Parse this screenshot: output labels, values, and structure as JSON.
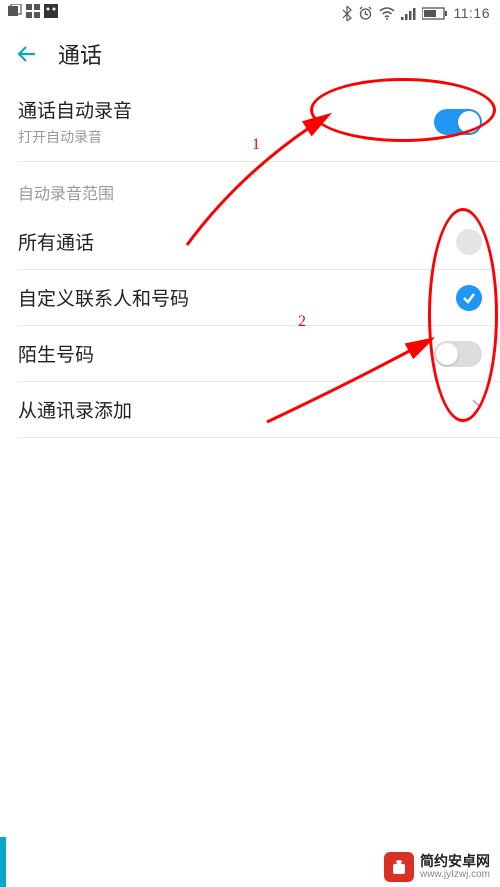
{
  "status": {
    "time": "11:16"
  },
  "header": {
    "title": "通话"
  },
  "auto_record": {
    "title": "通话自动录音",
    "subtitle": "打开自动录音"
  },
  "section_scope": {
    "header": "自动录音范围",
    "all_calls": "所有通话",
    "custom_contacts": "自定义联系人和号码",
    "unknown_numbers": "陌生号码",
    "add_from_contacts": "从通讯录添加"
  },
  "annot": {
    "num1": "1",
    "num2": "2"
  },
  "watermark": {
    "main": "简约安卓网",
    "sub": "www.jyIzwj.com"
  }
}
